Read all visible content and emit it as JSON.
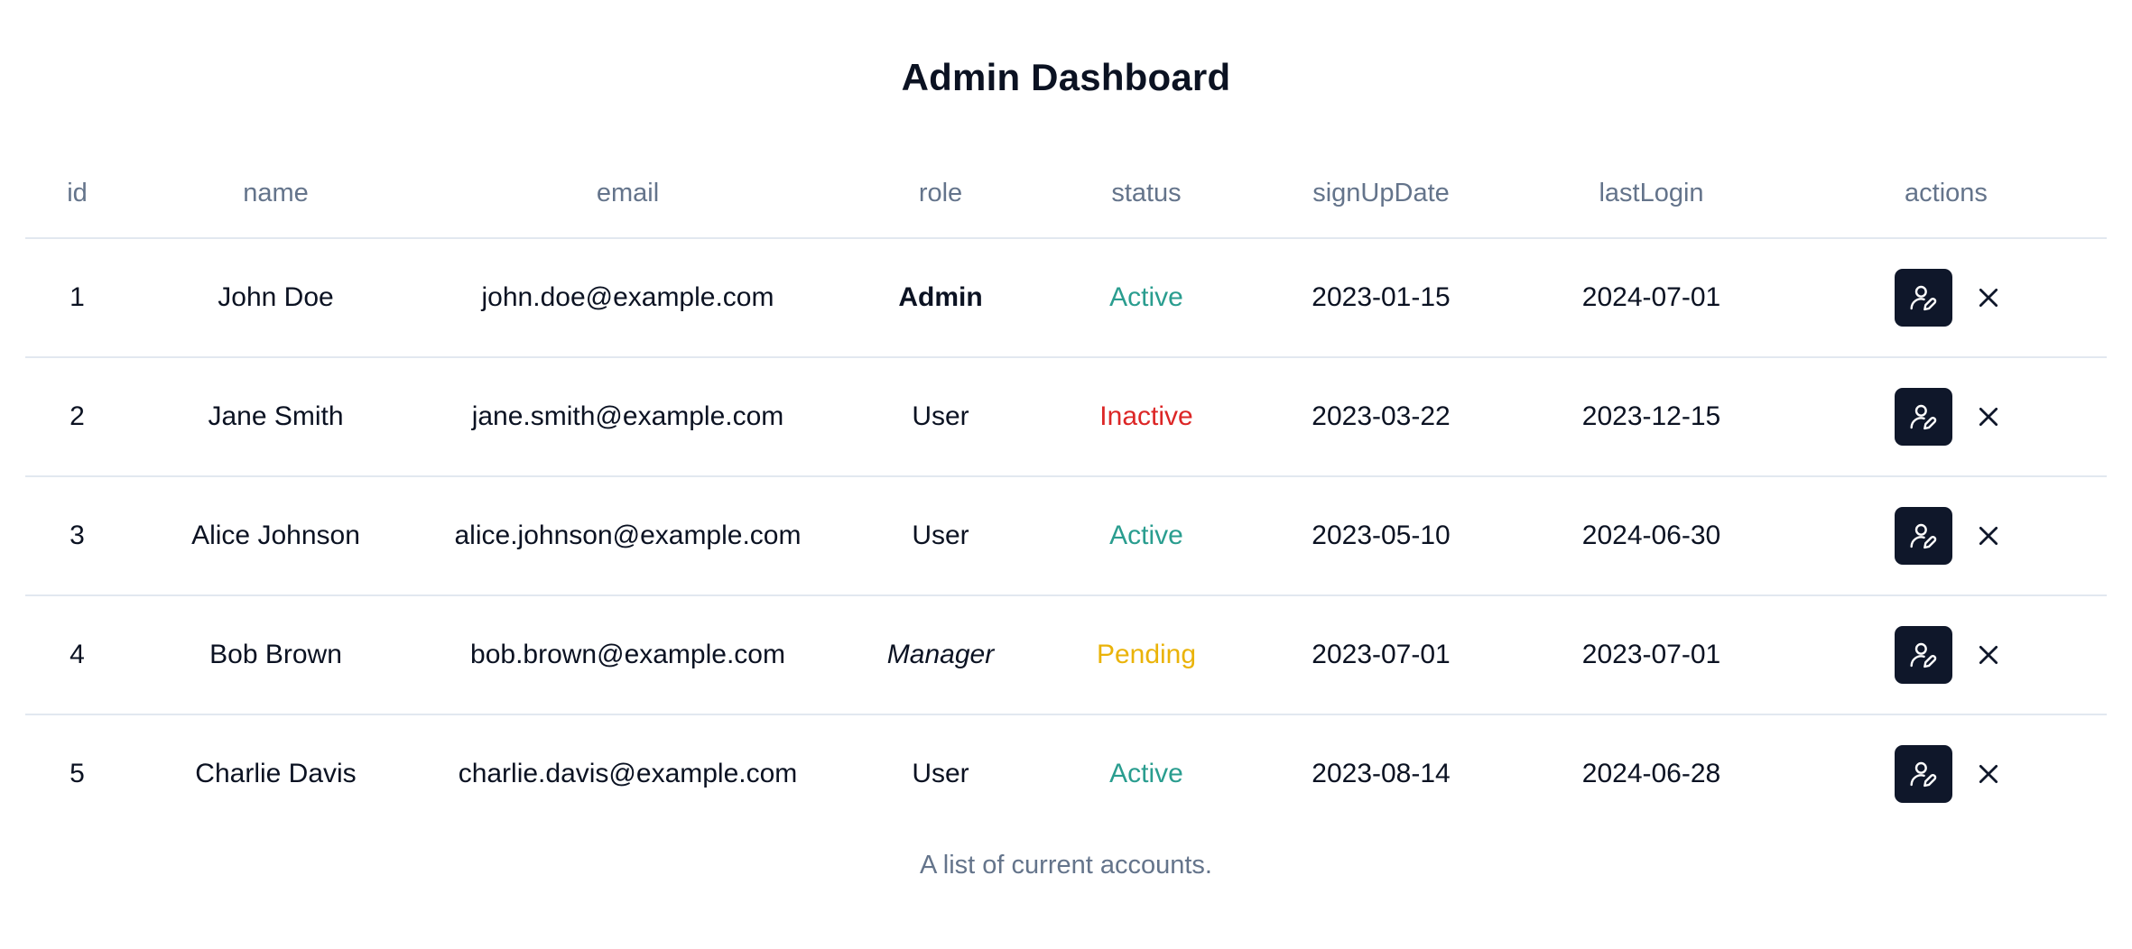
{
  "page": {
    "title": "Admin Dashboard",
    "caption": "A list of current accounts."
  },
  "table": {
    "columns": [
      "id",
      "name",
      "email",
      "role",
      "status",
      "signUpDate",
      "lastLogin",
      "actions"
    ],
    "rows": [
      {
        "id": "1",
        "name": "John Doe",
        "email": "john.doe@example.com",
        "role": "Admin",
        "status": "Active",
        "signUpDate": "2023-01-15",
        "lastLogin": "2024-07-01"
      },
      {
        "id": "2",
        "name": "Jane Smith",
        "email": "jane.smith@example.com",
        "role": "User",
        "status": "Inactive",
        "signUpDate": "2023-03-22",
        "lastLogin": "2023-12-15"
      },
      {
        "id": "3",
        "name": "Alice Johnson",
        "email": "alice.johnson@example.com",
        "role": "User",
        "status": "Active",
        "signUpDate": "2023-05-10",
        "lastLogin": "2024-06-30"
      },
      {
        "id": "4",
        "name": "Bob Brown",
        "email": "bob.brown@example.com",
        "role": "Manager",
        "status": "Pending",
        "signUpDate": "2023-07-01",
        "lastLogin": "2023-07-01"
      },
      {
        "id": "5",
        "name": "Charlie Davis",
        "email": "charlie.davis@example.com",
        "role": "User",
        "status": "Active",
        "signUpDate": "2023-08-14",
        "lastLogin": "2024-06-28"
      }
    ]
  },
  "icons": {
    "edit": "user-pen-icon",
    "delete": "close-icon"
  },
  "colors": {
    "active": "#2a9d8f",
    "inactive": "#dc2626",
    "pending": "#eab308",
    "header_text": "#64748b",
    "button_bg": "#0f172a"
  }
}
